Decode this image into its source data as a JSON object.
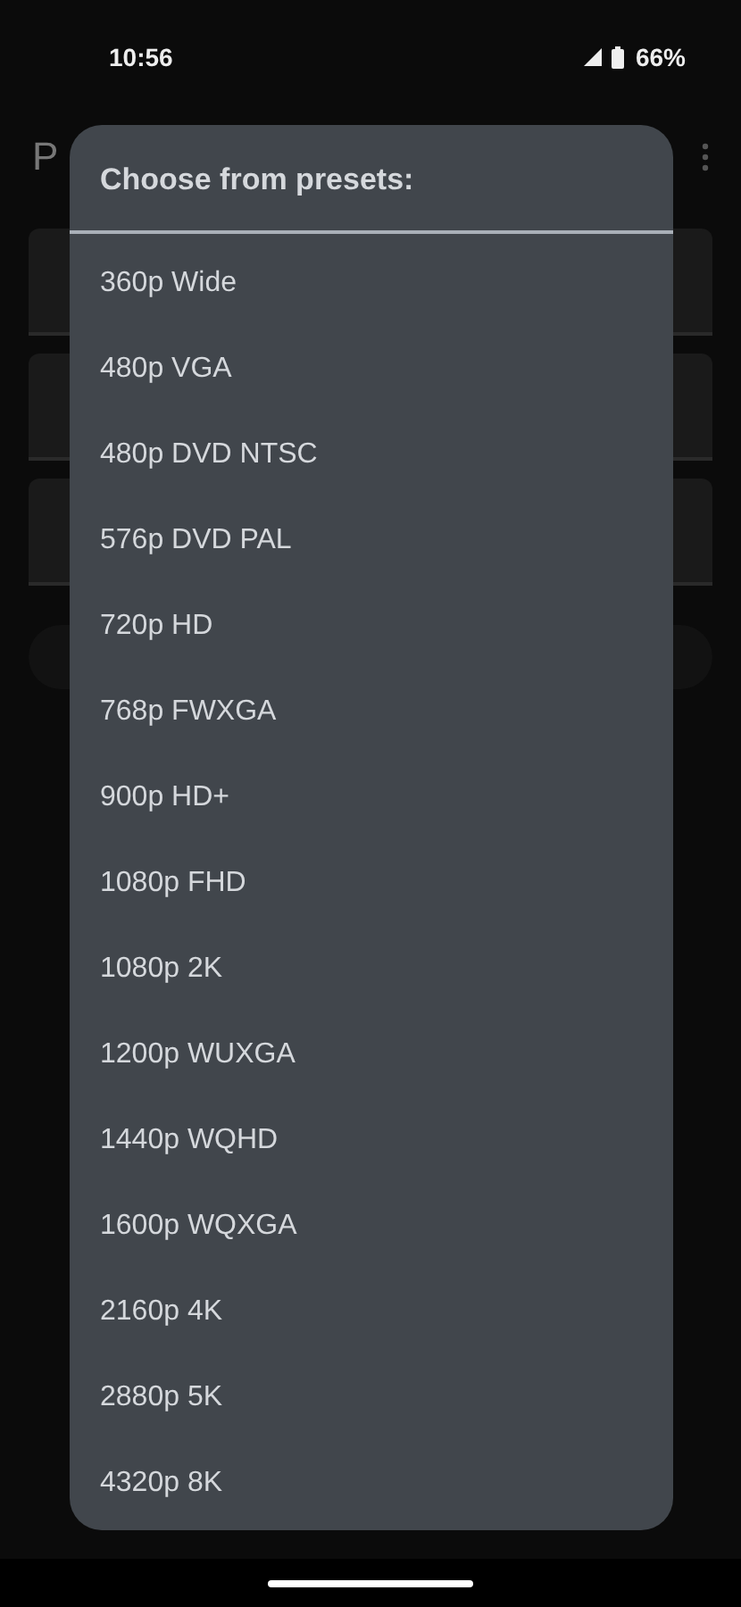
{
  "status_bar": {
    "time": "10:56",
    "battery": "66%"
  },
  "app_bar": {
    "title": "P"
  },
  "dialog": {
    "title": "Choose from presets:",
    "options": [
      {
        "label": "360p Wide"
      },
      {
        "label": "480p VGA"
      },
      {
        "label": "480p DVD NTSC"
      },
      {
        "label": "576p DVD PAL"
      },
      {
        "label": "720p HD"
      },
      {
        "label": "768p FWXGA"
      },
      {
        "label": "900p HD+"
      },
      {
        "label": "1080p FHD"
      },
      {
        "label": "1080p 2K"
      },
      {
        "label": "1200p WUXGA"
      },
      {
        "label": "1440p WQHD"
      },
      {
        "label": "1600p WQXGA"
      },
      {
        "label": "2160p 4K"
      },
      {
        "label": "2880p 5K"
      },
      {
        "label": "4320p 8K"
      }
    ]
  }
}
